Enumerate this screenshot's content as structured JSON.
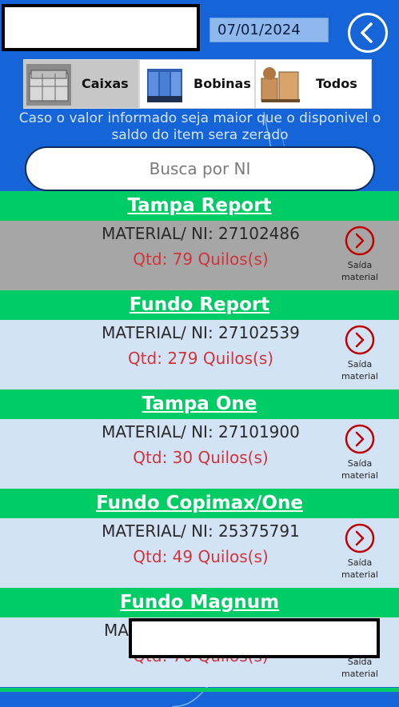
{
  "header": {
    "date": "07/01/2024"
  },
  "tabs": [
    {
      "label": "Caixas",
      "active": true
    },
    {
      "label": "Bobinas",
      "active": false
    },
    {
      "label": "Todos",
      "active": false
    }
  ],
  "notice": "Caso o valor informado seja maior que o disponivel o saldo do item sera zerado",
  "search": {
    "placeholder": "Busca por NI"
  },
  "items": [
    {
      "title": "Tampa Report",
      "ni": "MATERIAL/ NI: 27102486",
      "qtd": "Qtd: 79 Quilos(s)",
      "action": "Saída material",
      "selected": true
    },
    {
      "title": "Fundo Report",
      "ni": "MATERIAL/ NI: 27102539",
      "qtd": "Qtd: 279 Quilos(s)",
      "action": "Saída material",
      "selected": false
    },
    {
      "title": "Tampa One",
      "ni": "MATERIAL/ NI: 27101900",
      "qtd": "Qtd: 30 Quilos(s)",
      "action": "Saída material",
      "selected": false
    },
    {
      "title": "Fundo Copimax/One",
      "ni": "MATERIAL/ NI: 25375791",
      "qtd": "Qtd: 49 Quilos(s)",
      "action": "Saída material",
      "selected": false
    },
    {
      "title": "Fundo Magnum",
      "ni": "MA",
      "qtd": "Qtd: 70 Quilos(s)",
      "action": "Saída material",
      "selected": false
    }
  ],
  "colors": {
    "background": "#1565d8",
    "header_green": "#00cc66",
    "row_bg": "#d3e3f6",
    "row_selected": "#a6a6a6",
    "qty_red": "#d13438",
    "action_red": "#c00000"
  },
  "icons": {
    "back": "chevron-left-circle-icon",
    "go": "chevron-right-circle-icon"
  }
}
